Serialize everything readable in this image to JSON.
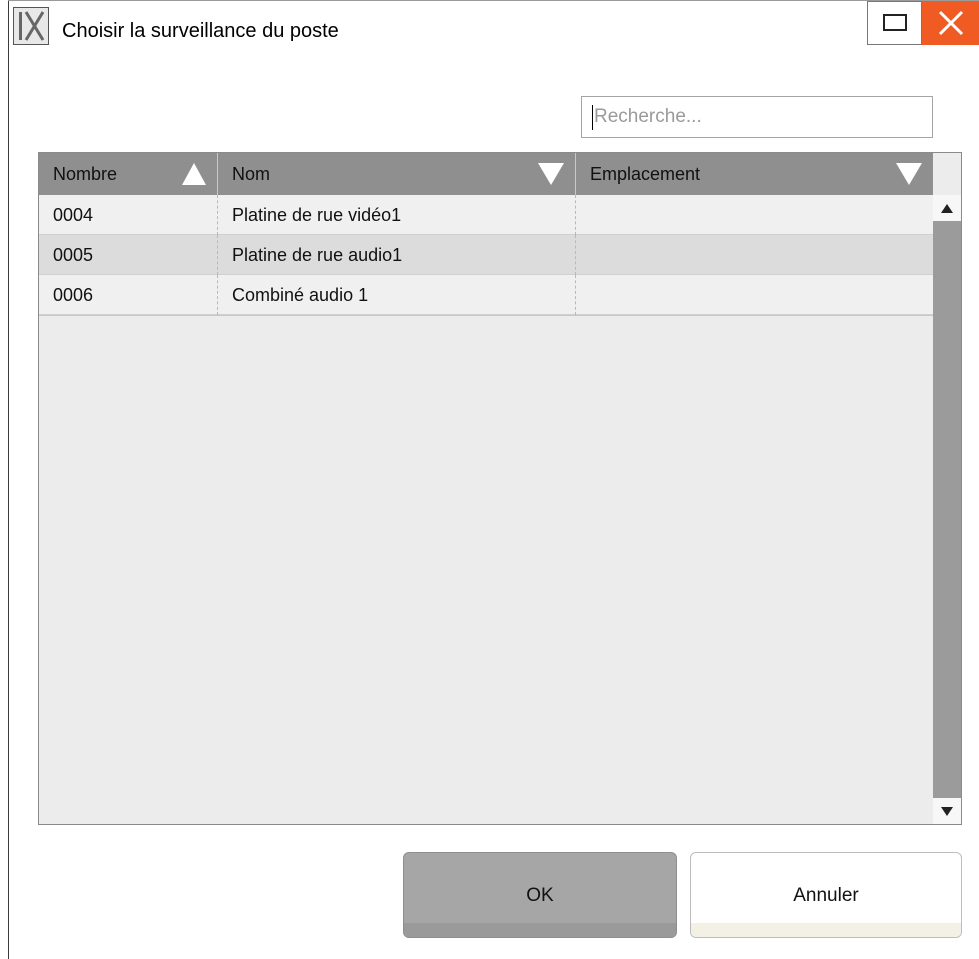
{
  "window": {
    "title": "Choisir la surveillance du poste",
    "icon": "ix-app-icon",
    "maximize_icon": "maximize-icon",
    "close_icon": "close-icon",
    "close_color": "#f05b24"
  },
  "search": {
    "placeholder": "Recherche...",
    "value": ""
  },
  "table": {
    "columns": [
      {
        "label": "Nombre",
        "sort_icon": "sort-ascending-icon"
      },
      {
        "label": "Nom",
        "sort_icon": "sort-descending-icon"
      },
      {
        "label": "Emplacement",
        "sort_icon": "sort-descending-icon"
      }
    ],
    "rows": [
      {
        "nombre": "0004",
        "nom": "Platine de rue vidéo1",
        "emplacement": ""
      },
      {
        "nombre": "0005",
        "nom": "Platine de rue audio1",
        "emplacement": ""
      },
      {
        "nombre": "0006",
        "nom": "Combiné audio 1",
        "emplacement": ""
      }
    ],
    "header_color": "#8f8f8f",
    "selected_row_color": "#dcdcdc"
  },
  "buttons": {
    "ok_label": "OK",
    "cancel_label": "Annuler"
  }
}
